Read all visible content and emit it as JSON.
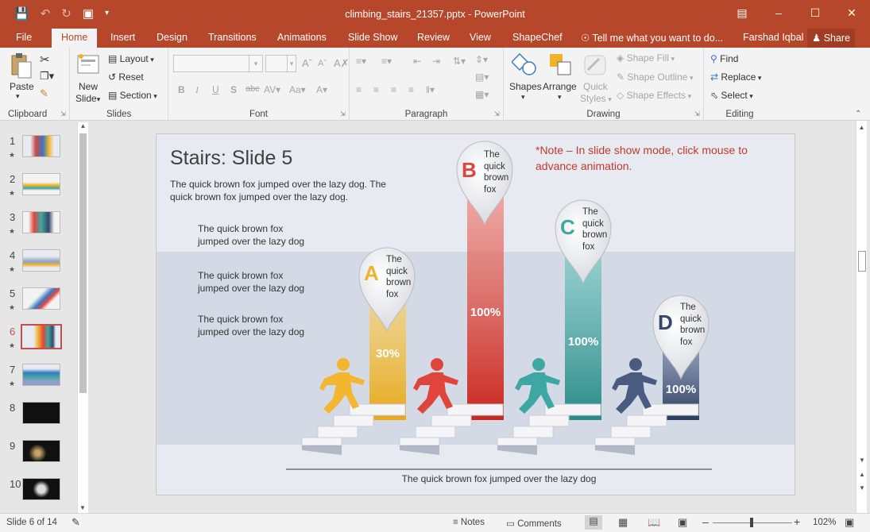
{
  "window": {
    "title": "climbing_stairs_21357.pptx - PowerPoint"
  },
  "tabs": [
    "File",
    "Home",
    "Insert",
    "Design",
    "Transitions",
    "Animations",
    "Slide Show",
    "Review",
    "View",
    "ShapeChef"
  ],
  "tell_me": "Tell me what you want to do...",
  "user": "Farshad Iqbal",
  "share": "Share",
  "ribbon": {
    "paste": "Paste",
    "clipboard": "Clipboard",
    "new_slide": "New",
    "new_slide2": "Slide",
    "layout": "Layout",
    "reset": "Reset",
    "section": "Section",
    "slides": "Slides",
    "font": "Font",
    "paragraph": "Paragraph",
    "shapes": "Shapes",
    "arrange": "Arrange",
    "quick": "Quick",
    "styles": "Styles",
    "shape_fill": "Shape Fill",
    "shape_outline": "Shape Outline",
    "shape_effects": "Shape Effects",
    "drawing": "Drawing",
    "find": "Find",
    "replace": "Replace",
    "select": "Select",
    "editing": "Editing"
  },
  "thumbnails": [
    "1",
    "2",
    "3",
    "4",
    "5",
    "6",
    "7",
    "8",
    "9",
    "10"
  ],
  "slide": {
    "title": "Stairs: Slide 5",
    "intro": "The quick brown fox jumped over the lazy dog. The quick brown fox jumped over the lazy dog.",
    "item1a": "The quick brown fox",
    "item1b": "jumped over the lazy dog",
    "item2a": "The quick brown fox",
    "item2b": "jumped over the lazy dog",
    "item3a": "The quick brown fox",
    "item3b": "jumped over the lazy dog",
    "note1": "*Note – In slide show mode, click mouse to",
    "note2": "advance animation.",
    "footer": "The quick brown fox jumped over the lazy dog",
    "pins": [
      {
        "letter": "A",
        "l1": "The",
        "l2": "quick",
        "l3": "brown",
        "l4": "fox",
        "pct": "30%",
        "color": "#f0b22b"
      },
      {
        "letter": "B",
        "l1": "The",
        "l2": "quick",
        "l3": "brown",
        "l4": "fox",
        "pct": "100%",
        "color": "#e0453c"
      },
      {
        "letter": "C",
        "l1": "The",
        "l2": "quick",
        "l3": "brown",
        "l4": "fox",
        "pct": "100%",
        "color": "#3fa7a3"
      },
      {
        "letter": "D",
        "l1": "The",
        "l2": "quick",
        "l3": "brown",
        "l4": "fox",
        "pct": "100%",
        "color": "#34476a"
      }
    ]
  },
  "status": {
    "slide_of": "Slide 6 of 14",
    "notes": "Notes",
    "comments": "Comments",
    "zoom": "102%"
  }
}
